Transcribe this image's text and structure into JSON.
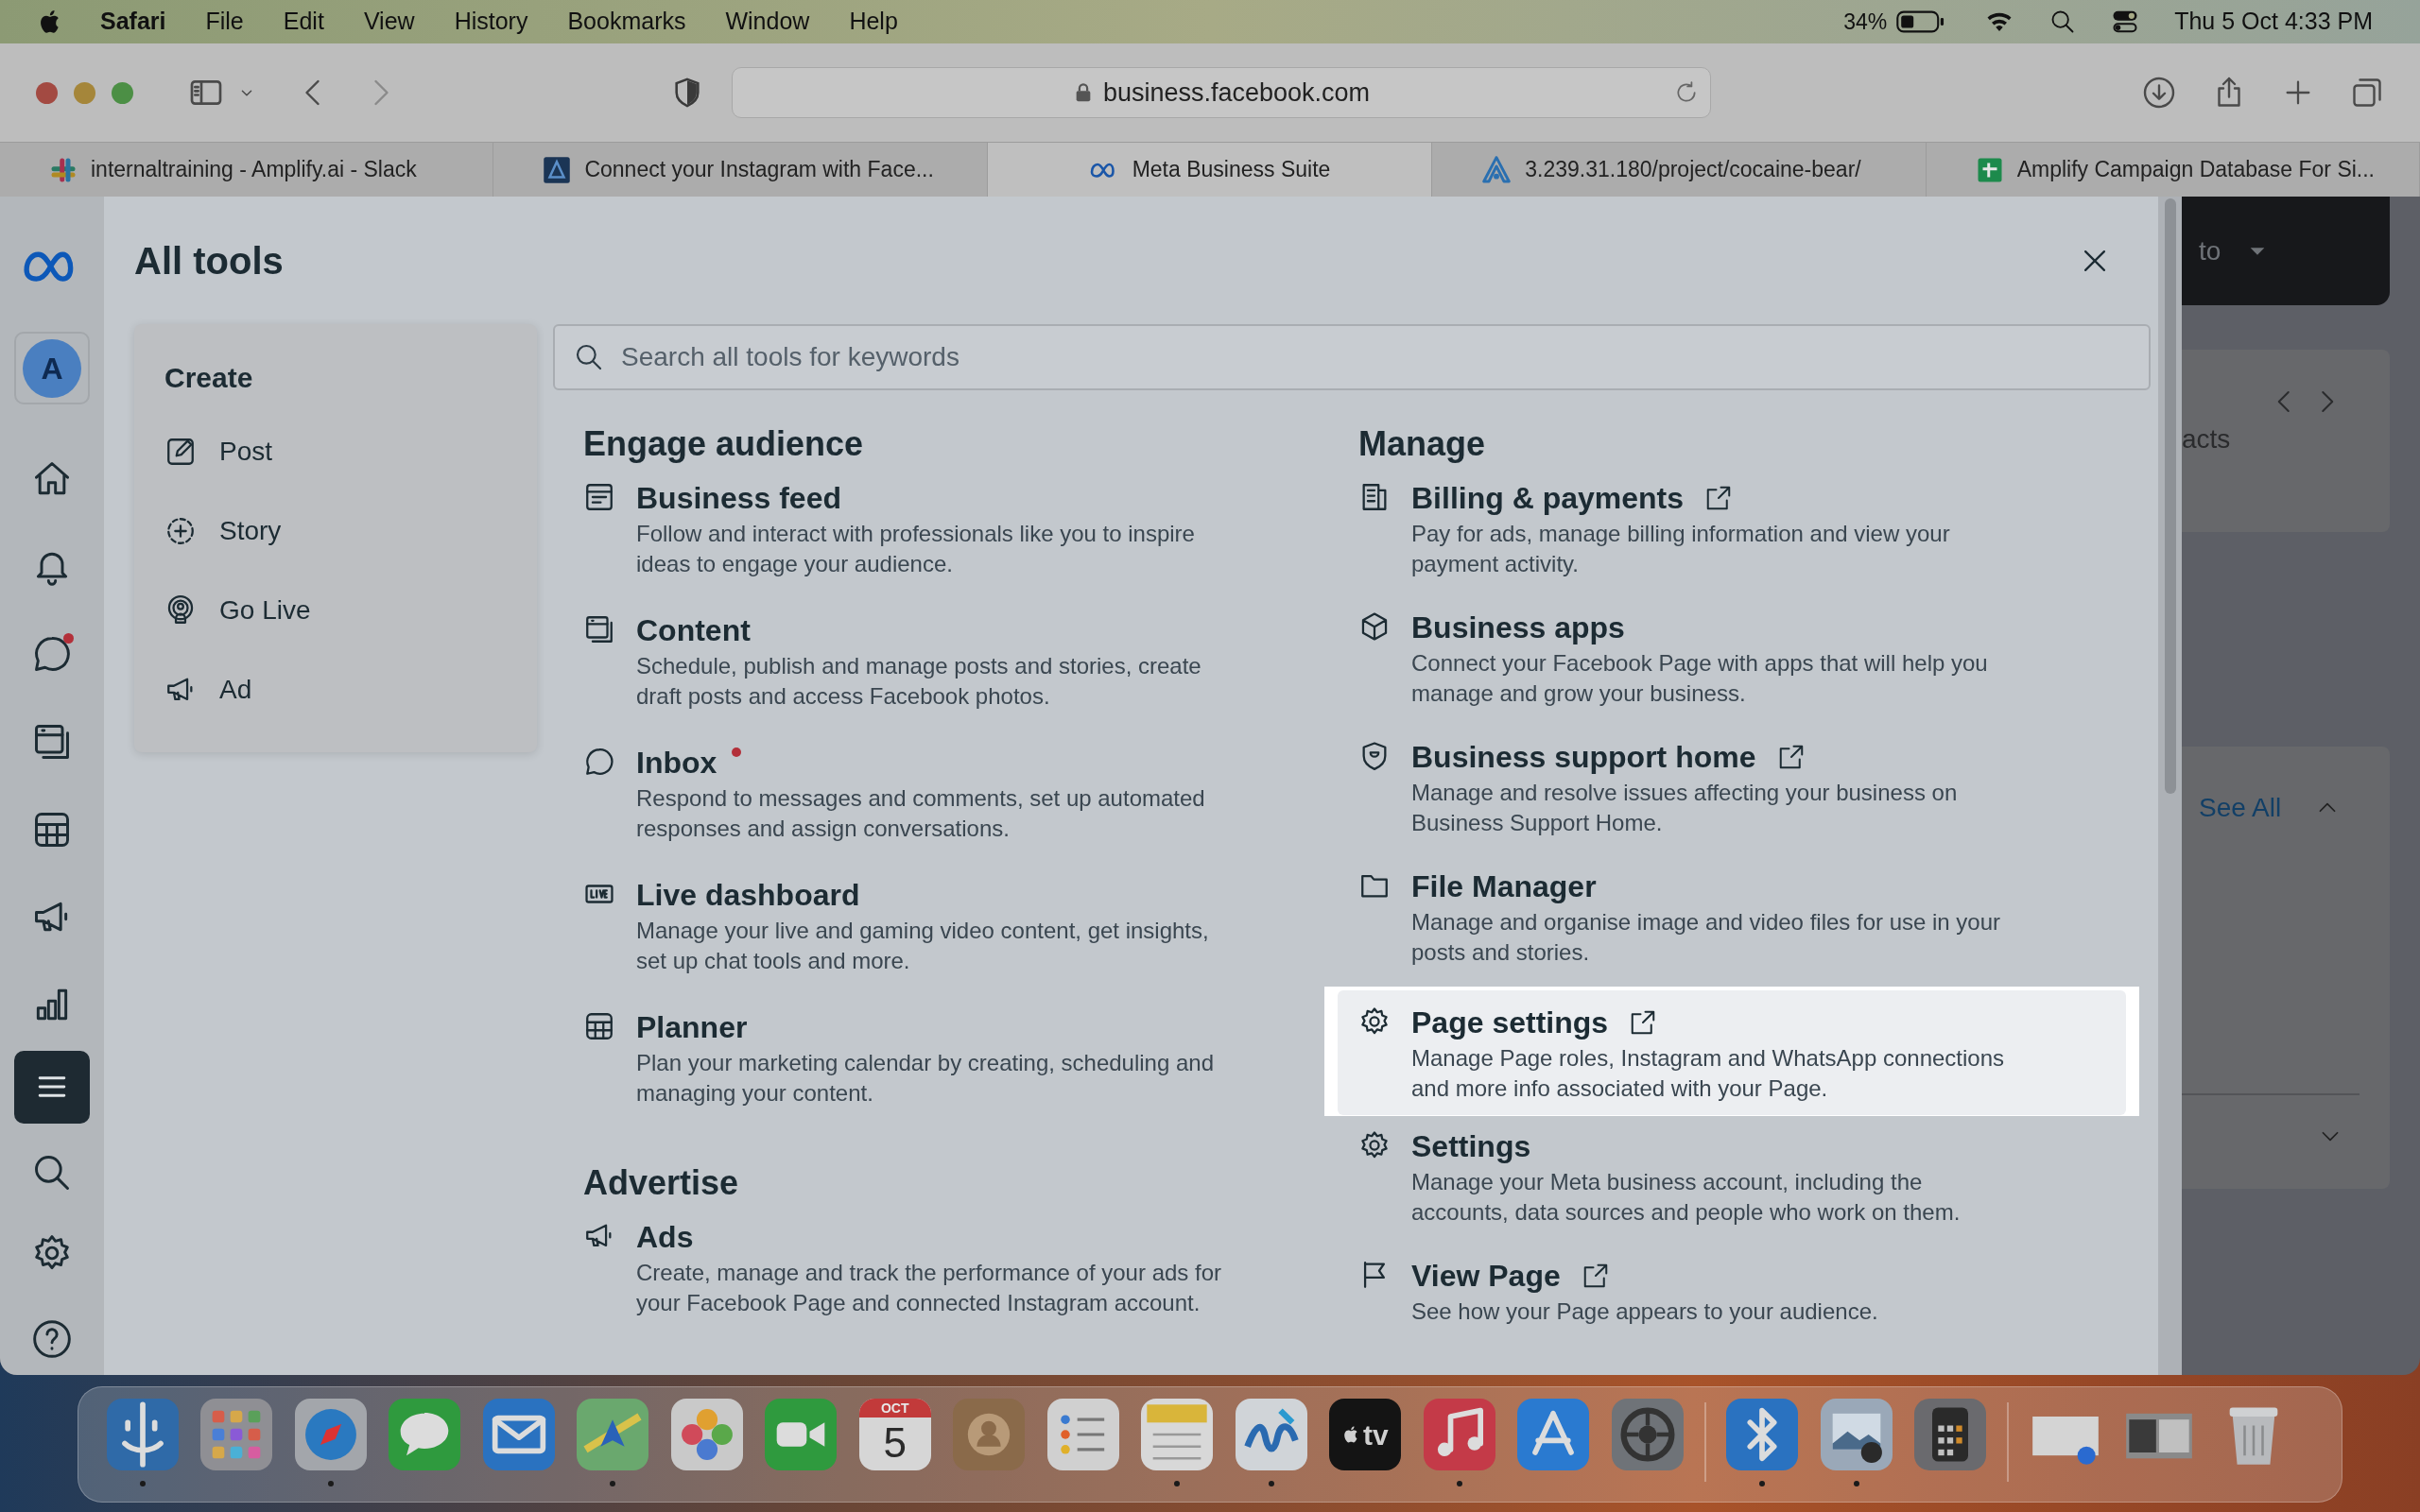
{
  "menu_bar": {
    "app": "Safari",
    "menus": [
      "File",
      "Edit",
      "View",
      "History",
      "Bookmarks",
      "Window",
      "Help"
    ],
    "battery": "34%",
    "clock": "Thu 5 Oct 4:33 PM"
  },
  "browser": {
    "url": "business.facebook.com",
    "tabs": [
      {
        "title": "internaltraining - Amplify.ai - Slack",
        "selected": false
      },
      {
        "title": "Connect your Instagram with Face...",
        "selected": false
      },
      {
        "title": "Meta Business Suite",
        "selected": true
      },
      {
        "title": "3.239.31.180/project/cocaine-bear/",
        "selected": false
      },
      {
        "title": "Amplify Campaign Database For Si...",
        "selected": false
      }
    ]
  },
  "nav_rail": {
    "avatar": "A",
    "items": [
      {
        "selected": false,
        "dot": false
      },
      {
        "selected": false,
        "dot": false
      },
      {
        "selected": false,
        "dot": true
      },
      {
        "selected": false,
        "dot": false
      },
      {
        "selected": false,
        "dot": false
      },
      {
        "selected": false,
        "dot": false
      },
      {
        "selected": false,
        "dot": false
      },
      {
        "selected": true,
        "dot": false
      },
      {
        "selected": false,
        "dot": false
      },
      {
        "selected": false,
        "dot": false
      },
      {
        "selected": false,
        "dot": false
      }
    ]
  },
  "all_tools": {
    "title": "All tools",
    "search": {
      "placeholder": "Search all tools for keywords"
    },
    "create": {
      "title": "Create",
      "items": [
        "Post",
        "Story",
        "Go Live",
        "Ad"
      ]
    },
    "columns": [
      [
        {
          "title": "Engage audience",
          "items": [
            {
              "title": "Business feed",
              "description": "Follow and interact with professionals like you to inspire ideas to engage your audience.",
              "external": false,
              "dot": false,
              "highlighted": false
            },
            {
              "title": "Content",
              "description": "Schedule, publish and manage posts and stories, create draft posts and access Facebook photos.",
              "external": false,
              "dot": false,
              "highlighted": false
            },
            {
              "title": "Inbox",
              "description": "Respond to messages and comments, set up automated responses and assign conversations.",
              "external": false,
              "dot": true,
              "highlighted": false
            },
            {
              "title": "Live dashboard",
              "description": "Manage your live and gaming video content, get insights, set up chat tools and more.",
              "external": false,
              "dot": false,
              "highlighted": false
            },
            {
              "title": "Planner",
              "description": "Plan your marketing calendar by creating, scheduling and managing your content.",
              "external": false,
              "dot": false,
              "highlighted": false
            }
          ]
        },
        {
          "title": "Advertise",
          "items": [
            {
              "title": "Ads",
              "description": "Create, manage and track the performance of your ads for your Facebook Page and connected Instagram account.",
              "external": false,
              "dot": false,
              "highlighted": false
            }
          ]
        }
      ],
      [
        {
          "title": "Manage",
          "items": [
            {
              "title": "Billing & payments",
              "description": "Pay for ads, manage billing information and view your payment activity.",
              "external": true,
              "dot": false,
              "highlighted": false
            },
            {
              "title": "Business apps",
              "description": "Connect your Facebook Page with apps that will help you manage and grow your business.",
              "external": false,
              "dot": false,
              "highlighted": false
            },
            {
              "title": "Business support home",
              "description": "Manage and resolve issues affecting your business on Business Support Home.",
              "external": true,
              "dot": false,
              "highlighted": false
            },
            {
              "title": "File Manager",
              "description": "Manage and organise image and video files for use in your posts and stories.",
              "external": false,
              "dot": false,
              "highlighted": false
            },
            {
              "title": "Page settings",
              "description": "Manage Page roles, Instagram and WhatsApp connections and more info associated with your Page.",
              "external": true,
              "dot": false,
              "highlighted": true
            },
            {
              "title": "Settings",
              "description": "Manage your Meta business account, including the accounts, data sources and people who work on them.",
              "external": false,
              "dot": false,
              "highlighted": false
            },
            {
              "title": "View Page",
              "description": "See how your Page appears to your audience.",
              "external": true,
              "dot": false,
              "highlighted": false
            }
          ]
        }
      ]
    ]
  },
  "background_page": {
    "button_text": "to",
    "card_text": "acts",
    "see_all": "See All"
  },
  "dock": {
    "calendar": {
      "month": "OCT",
      "day": "5"
    },
    "tv_label": "tv",
    "items": [
      {
        "running": true
      },
      {
        "running": false
      },
      {
        "running": true
      },
      {
        "running": false
      },
      {
        "running": false
      },
      {
        "running": true
      },
      {
        "running": false
      },
      {
        "running": false
      },
      {
        "running": false
      },
      {
        "running": false
      },
      {
        "running": false
      },
      {
        "running": true
      },
      {
        "running": true
      },
      {
        "running": false
      },
      {
        "running": true
      },
      {
        "running": false
      },
      {
        "running": false
      },
      {
        "running": true
      },
      {
        "running": true
      },
      {
        "running": false
      },
      {
        "running": false
      },
      {
        "running": false
      },
      {
        "running": false
      }
    ]
  }
}
